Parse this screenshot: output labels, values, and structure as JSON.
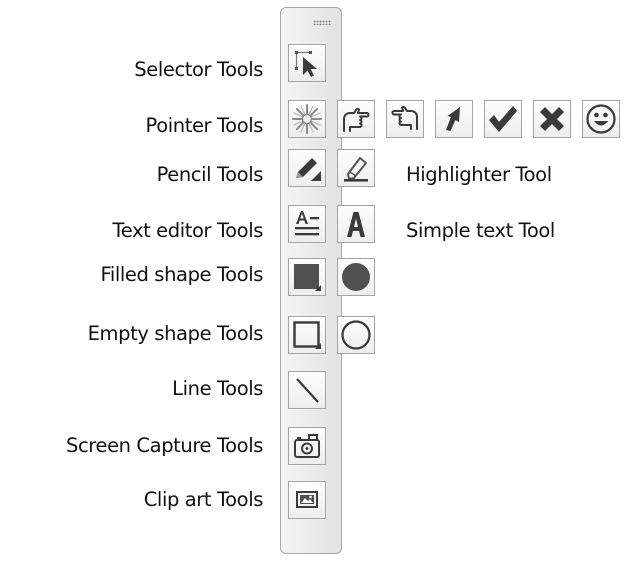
{
  "labels": {
    "selector": "Selector Tools",
    "pointer": "Pointer Tools",
    "pencil": "Pencil Tools",
    "text_editor": "Text editor Tools",
    "filled_shape": "Filled shape Tools",
    "empty_shape": "Empty shape Tools",
    "line": "Line Tools",
    "screen_capture": "Screen Capture Tools",
    "clip_art": "Clip art Tools"
  },
  "side_labels": {
    "highlighter": "Highlighter Tool",
    "simple_text": "Simple text Tool"
  },
  "icons": {
    "selector": "selector-arrow-icon",
    "pointers": [
      "sun-burst-icon",
      "hand-pointing-right-icon",
      "hand-pointing-left-icon",
      "arrow-icon",
      "check-mark-icon",
      "x-mark-icon",
      "smiley-icon"
    ],
    "pencil": "pencil-icon",
    "highlighter": "highlighter-icon",
    "text_editor": "text-editor-icon",
    "simple_text": "letter-a-icon",
    "filled_square": "filled-square-icon",
    "filled_circle": "filled-circle-icon",
    "empty_square": "empty-square-icon",
    "empty_circle": "empty-circle-icon",
    "line": "line-icon",
    "camera": "camera-icon",
    "clip_art": "clip-art-icon"
  },
  "colors": {
    "icon": "#3a3a3a",
    "border": "#a4a4a4",
    "toolbar_bg": "#eaeaea"
  }
}
